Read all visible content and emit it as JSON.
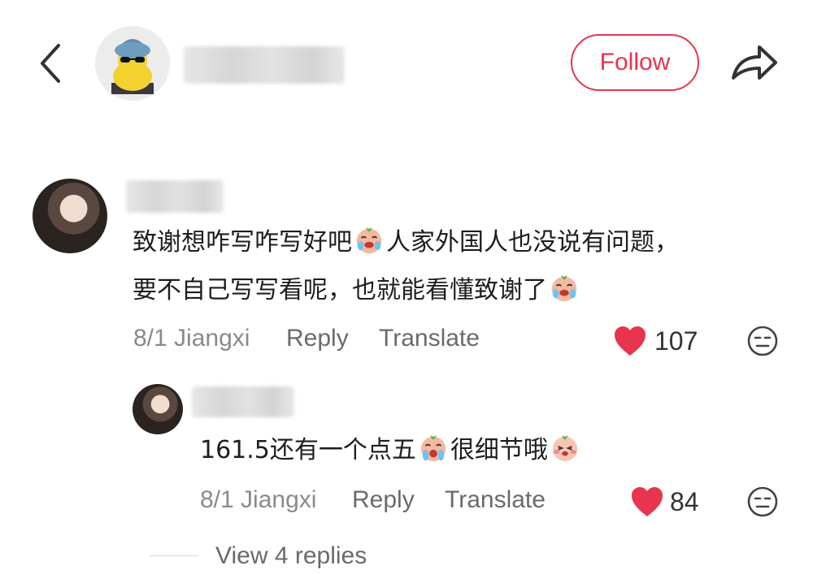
{
  "header": {
    "follow_label": "Follow",
    "accent_color": "#e8344c"
  },
  "comments": [
    {
      "lines": [
        "致谢想咋写咋写好吧",
        "人家外国人也没说有问题，",
        "要不自己写写看呢，也就能看懂致谢了"
      ],
      "date": "8/1 Jiangxi",
      "reply_label": "Reply",
      "translate_label": "Translate",
      "likes": "107"
    },
    {
      "lines": [
        "161.5还有一个点五",
        "很细节哦"
      ],
      "date": "8/1 Jiangxi",
      "reply_label": "Reply",
      "translate_label": "Translate",
      "likes": "84"
    }
  ],
  "view_replies_label": "View 4 replies",
  "icons": [
    "back-icon",
    "share-icon",
    "heart-icon",
    "dislike-face-icon",
    "crying-emoji-icon",
    "shy-emoji-icon"
  ]
}
